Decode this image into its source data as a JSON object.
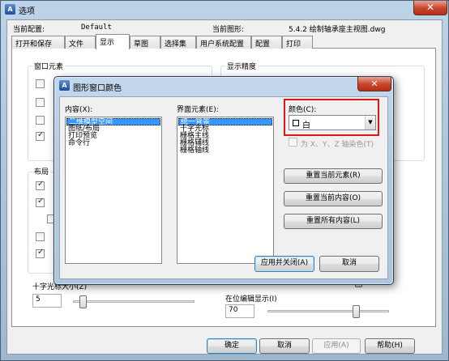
{
  "outer_window": {
    "title": "选项",
    "close_glyph": "✕",
    "app_icon": "autocad-icon",
    "current_profile_label": "当前配置:",
    "current_profile_value": "Default",
    "current_drawing_label": "当前图形:",
    "current_drawing_value": "5.4.2 绘制轴承座主视图.dwg",
    "tabs": [
      "打开和保存",
      "文件",
      "显示",
      "草图",
      "选择集",
      "用户系统配置",
      "配置",
      "打印"
    ],
    "active_tab": "显示",
    "window_elements_group": "窗口元素",
    "display_precision_group": "显示精度",
    "layout_group": "布局",
    "crosshair_label": "十字光标大小(Z)",
    "crosshair_value": "5",
    "crosshair_level": 0.05,
    "inplace_edit_label": "在位编辑显示(I)",
    "inplace_edit_value": "70",
    "inplace_edit_level": 0.7,
    "buttons": {
      "ok": "确定",
      "cancel": "取消",
      "apply": "应用(A)",
      "help": "帮助(H)"
    }
  },
  "dialog": {
    "title": "图形窗口颜色",
    "close_glyph": "✕",
    "app_icon": "autocad-icon",
    "context_label": "内容(X):",
    "context_items": [
      "二维模型空间",
      "图纸/布局",
      "打印预览",
      "命令行"
    ],
    "context_selected": 0,
    "interface_label": "界面元素(E):",
    "interface_items": [
      "统一背景",
      "十字光标",
      "栅格主线",
      "栅格辅线",
      "栅格轴线"
    ],
    "interface_selected": 0,
    "color_label": "颜色(C):",
    "color_value": "白",
    "tint_label": "为 X、Y、Z 轴染色(T)",
    "buttons": {
      "restore_element": "重置当前元素(R)",
      "restore_context": "重置当前内容(O)",
      "restore_all": "重置所有内容(L)",
      "apply_close": "应用并关闭(A)",
      "cancel": "取消"
    },
    "highlight_color": "#e0161b",
    "selection_color": "#3399ff"
  }
}
